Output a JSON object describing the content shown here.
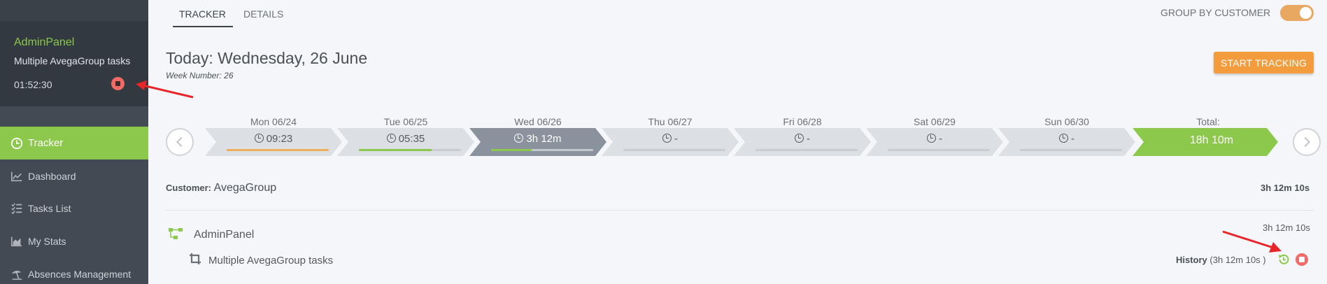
{
  "sidebar": {
    "timer": {
      "project": "AdminPanel",
      "task": "Multiple AvegaGroup tasks",
      "elapsed": "01:52:30"
    },
    "nav": [
      {
        "label": "Tracker",
        "icon": "clock-icon",
        "active": true
      },
      {
        "label": "Dashboard",
        "icon": "line-chart-icon",
        "active": false
      },
      {
        "label": "Tasks List",
        "icon": "task-list-icon",
        "active": false
      },
      {
        "label": "My Stats",
        "icon": "area-chart-icon",
        "active": false
      },
      {
        "label": "Absences Management",
        "icon": "beach-umbrella-icon",
        "active": false
      }
    ]
  },
  "tabs": [
    {
      "label": "TRACKER",
      "active": true
    },
    {
      "label": "DETAILS",
      "active": false
    }
  ],
  "group_by": {
    "label": "GROUP BY CUSTOMER",
    "enabled": true
  },
  "header": {
    "today": "Today: Wednesday, 26 June",
    "week": "Week Number: 26",
    "start_button": "START TRACKING"
  },
  "week": {
    "days": [
      {
        "label": "Mon 06/24",
        "value": "09:23",
        "progress": 1.0,
        "bar_color": "#f0ad5a",
        "selected": false
      },
      {
        "label": "Tue 06/25",
        "value": "05:35",
        "progress": 0.71,
        "bar_color": "#8cc84b",
        "selected": false
      },
      {
        "label": "Wed 06/26",
        "value": "3h 12m",
        "progress": 0.4,
        "bar_color": "#8cc84b",
        "selected": true
      },
      {
        "label": "Thu 06/27",
        "value": "-",
        "progress": 0,
        "bar_color": "#8cc84b",
        "selected": false
      },
      {
        "label": "Fri 06/28",
        "value": "-",
        "progress": 0,
        "bar_color": "#8cc84b",
        "selected": false
      },
      {
        "label": "Sat 06/29",
        "value": "-",
        "progress": 0,
        "bar_color": "#8cc84b",
        "selected": false
      },
      {
        "label": "Sun 06/30",
        "value": "-",
        "progress": 0,
        "bar_color": "#8cc84b",
        "selected": false
      }
    ],
    "total_label": "Total:",
    "total_value": "18h 10m"
  },
  "customer": {
    "prefix": "Customer:",
    "name": "AvegaGroup",
    "total": "3h 12m 10s"
  },
  "project": {
    "name": "AdminPanel",
    "total": "3h 12m 10s"
  },
  "task": {
    "name": "Multiple AvegaGroup tasks",
    "history_label": "History",
    "history_value": "(3h 12m 10s )"
  },
  "colors": {
    "accent_green": "#8cc84b",
    "accent_orange": "#f39c3d",
    "stop_red": "#f06a67",
    "sidebar": "#424a53"
  }
}
